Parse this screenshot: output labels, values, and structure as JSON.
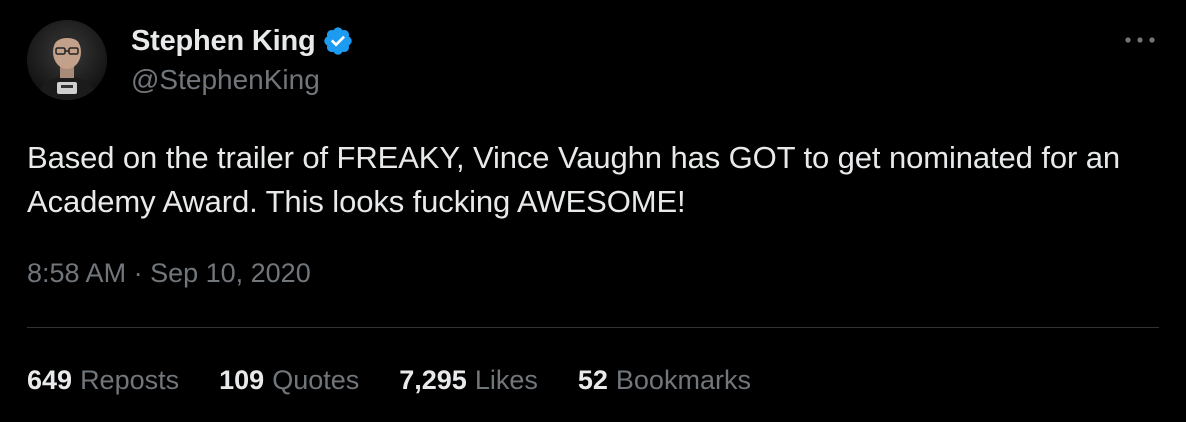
{
  "author": {
    "display_name": "Stephen King",
    "handle": "@StephenKing",
    "verified": true,
    "avatar_icon": "avatar-photo"
  },
  "more_icon": "more-horizontal-icon",
  "tweet": {
    "text": "Based on the trailer of FREAKY, Vince Vaughn has GOT to get nominated for an Academy Award. This looks fucking AWESOME!",
    "time": "8:58 AM",
    "separator": " · ",
    "date": "Sep 10, 2020"
  },
  "stats": [
    {
      "count": "649",
      "label": "Reposts"
    },
    {
      "count": "109",
      "label": "Quotes"
    },
    {
      "count": "7,295",
      "label": "Likes"
    },
    {
      "count": "52",
      "label": "Bookmarks"
    }
  ],
  "colors": {
    "background": "#000000",
    "text_primary": "#e7e9ea",
    "text_secondary": "#71767b",
    "verified_blue": "#1d9bf0",
    "divider": "#2f3336"
  }
}
